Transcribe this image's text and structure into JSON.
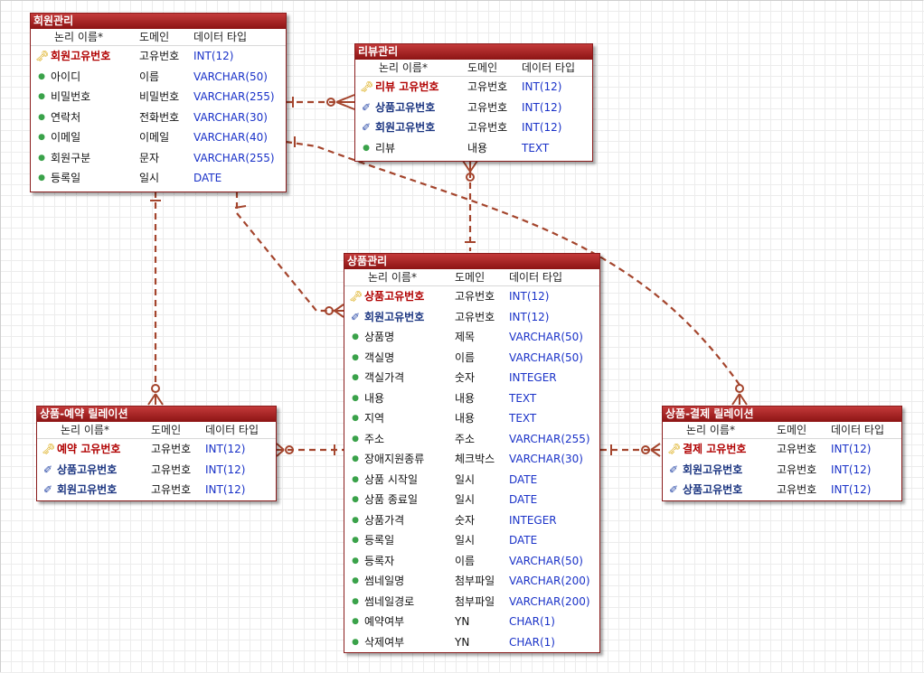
{
  "header": {
    "name": "논리 이름*",
    "domain": "도메인",
    "type": "데이터 타입"
  },
  "member": {
    "title": "회원관리",
    "rows": [
      {
        "icon": "key-icon",
        "name": "회원고유번호",
        "domain": "고유번호",
        "type": "INT(12)"
      },
      {
        "icon": "attribute-icon",
        "name": "아이디",
        "domain": "이름",
        "type": "VARCHAR(50)"
      },
      {
        "icon": "attribute-icon",
        "name": "비밀번호",
        "domain": "비밀번호",
        "type": "VARCHAR(255)"
      },
      {
        "icon": "attribute-icon",
        "name": "연락처",
        "domain": "전화번호",
        "type": "VARCHAR(30)"
      },
      {
        "icon": "attribute-icon",
        "name": "이메일",
        "domain": "이메일",
        "type": "VARCHAR(40)"
      },
      {
        "icon": "attribute-icon",
        "name": "회원구분",
        "domain": "문자",
        "type": "VARCHAR(255)"
      },
      {
        "icon": "attribute-icon",
        "name": "등록일",
        "domain": "일시",
        "type": "DATE"
      }
    ]
  },
  "review": {
    "title": "리뷰관리",
    "rows": [
      {
        "icon": "key-icon",
        "name": "리뷰 고유번호",
        "domain": "고유번호",
        "type": "INT(12)"
      },
      {
        "icon": "foreign-key-icon",
        "name": "상품고유번호",
        "domain": "고유번호",
        "type": "INT(12)"
      },
      {
        "icon": "foreign-key-icon",
        "name": "회원고유번호",
        "domain": "고유번호",
        "type": "INT(12)"
      },
      {
        "icon": "attribute-icon",
        "name": "리뷰",
        "domain": "내용",
        "type": "TEXT"
      }
    ]
  },
  "product": {
    "title": "상품관리",
    "rows": [
      {
        "icon": "key-icon",
        "name": "상품고유번호",
        "domain": "고유번호",
        "type": "INT(12)"
      },
      {
        "icon": "foreign-key-icon",
        "name": "회원고유번호",
        "domain": "고유번호",
        "type": "INT(12)"
      },
      {
        "icon": "attribute-icon",
        "name": "상품명",
        "domain": "제목",
        "type": "VARCHAR(50)"
      },
      {
        "icon": "attribute-icon",
        "name": "객실명",
        "domain": "이름",
        "type": "VARCHAR(50)"
      },
      {
        "icon": "attribute-icon",
        "name": "객실가격",
        "domain": "숫자",
        "type": "INTEGER"
      },
      {
        "icon": "attribute-icon",
        "name": "내용",
        "domain": "내용",
        "type": "TEXT"
      },
      {
        "icon": "attribute-icon",
        "name": "지역",
        "domain": "내용",
        "type": "TEXT"
      },
      {
        "icon": "attribute-icon",
        "name": "주소",
        "domain": "주소",
        "type": "VARCHAR(255)"
      },
      {
        "icon": "attribute-icon",
        "name": "장애지원종류",
        "domain": "체크박스",
        "type": "VARCHAR(30)"
      },
      {
        "icon": "attribute-icon",
        "name": "상품 시작일",
        "domain": "일시",
        "type": "DATE"
      },
      {
        "icon": "attribute-icon",
        "name": "상품 종료일",
        "domain": "일시",
        "type": "DATE"
      },
      {
        "icon": "attribute-icon",
        "name": "상품가격",
        "domain": "숫자",
        "type": "INTEGER"
      },
      {
        "icon": "attribute-icon",
        "name": "등록일",
        "domain": "일시",
        "type": "DATE"
      },
      {
        "icon": "attribute-icon",
        "name": "등록자",
        "domain": "이름",
        "type": "VARCHAR(50)"
      },
      {
        "icon": "attribute-icon",
        "name": "썸네일명",
        "domain": "첨부파일",
        "type": "VARCHAR(200)"
      },
      {
        "icon": "attribute-icon",
        "name": "썸네일경로",
        "domain": "첨부파일",
        "type": "VARCHAR(200)"
      },
      {
        "icon": "attribute-icon",
        "name": "예약여부",
        "domain": "YN",
        "type": "CHAR(1)"
      },
      {
        "icon": "attribute-icon",
        "name": "삭제여부",
        "domain": "YN",
        "type": "CHAR(1)"
      }
    ]
  },
  "reservation": {
    "title": "상품-예약 릴레이션",
    "rows": [
      {
        "icon": "key-icon",
        "name": "예약 고유번호",
        "domain": "고유번호",
        "type": "INT(12)"
      },
      {
        "icon": "foreign-key-icon",
        "name": "상품고유번호",
        "domain": "고유번호",
        "type": "INT(12)"
      },
      {
        "icon": "foreign-key-icon",
        "name": "회원고유번호",
        "domain": "고유번호",
        "type": "INT(12)"
      }
    ]
  },
  "payment": {
    "title": "상품-결제 릴레이션",
    "rows": [
      {
        "icon": "key-icon",
        "name": "결제 고유번호",
        "domain": "고유번호",
        "type": "INT(12)"
      },
      {
        "icon": "foreign-key-icon",
        "name": "회원고유번호",
        "domain": "고유번호",
        "type": "INT(12)"
      },
      {
        "icon": "foreign-key-icon",
        "name": "상품고유번호",
        "domain": "고유번호",
        "type": "INT(12)"
      }
    ]
  },
  "colors": {
    "title_bar": "#a01f1f",
    "relationship_line": "#a4452d",
    "primary_key_text": "#b00000",
    "foreign_key_text": "#1a3480",
    "type_text": "#1a32c8"
  }
}
